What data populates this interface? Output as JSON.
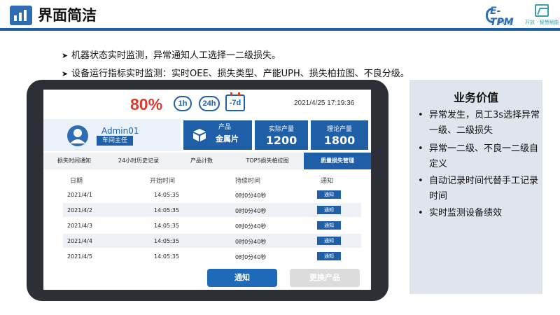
{
  "header": {
    "title": "界面简洁",
    "brand_tpm": "E-TPM",
    "brand_tpm_sub": "学汇通",
    "brand_right_sub": "开放 · 智慧赋能"
  },
  "bullets": [
    "机器状态实时监测，异常通知人工选择一二级损失。",
    "设备运行指标实时监测：实时OEE、损失类型、产能UPH、损失柏拉图、不良分级。"
  ],
  "screen": {
    "oee": "80%",
    "pills": [
      "1h",
      "24h"
    ],
    "calendar_label": "-7d",
    "datetime": "2021/4/25 17:19:36",
    "user": {
      "name": "Admin01",
      "role": "车间主任"
    },
    "product_card": {
      "label": "产品",
      "value": "金属片"
    },
    "actual_card": {
      "label": "实际产量",
      "value": "1200"
    },
    "theory_card": {
      "label": "理论产量",
      "value": "1800"
    },
    "tabs": [
      "损失时间通知",
      "24小时历史记录",
      "产品计数",
      "TOP5损失柏拉图",
      "质量损失管理"
    ],
    "columns": [
      "日期",
      "开始时间",
      "持续时间",
      "通知"
    ],
    "rows": [
      {
        "date": "2021/4/1",
        "start": "14:05:35",
        "duration": "0时0分40秒",
        "action": "通知"
      },
      {
        "date": "2021/4/2",
        "start": "14:05:35",
        "duration": "0时0分40秒",
        "action": "通知"
      },
      {
        "date": "2021/4/3",
        "start": "14:05:35",
        "duration": "0时0分40秒",
        "action": "通知"
      },
      {
        "date": "2021/4/4",
        "start": "14:05:35",
        "duration": "0时0分40秒",
        "action": "通知"
      },
      {
        "date": "2021/4/5",
        "start": "14:05:35",
        "duration": "0时0分40秒",
        "action": "通知"
      }
    ],
    "buttons": {
      "notify": "通知",
      "change": "更换产品"
    }
  },
  "panel": {
    "title": "业务价值",
    "items": [
      "异常发生，员工3s选择异常一级、二级损失",
      "异常一二级、不良一二级自定义",
      "自动记录时间代替手工记录时间",
      "实时监测设备绩效"
    ]
  },
  "colors": {
    "accent": "#1f5fa8",
    "oee": "#e03a2f",
    "panel": "#dfe5ed"
  }
}
